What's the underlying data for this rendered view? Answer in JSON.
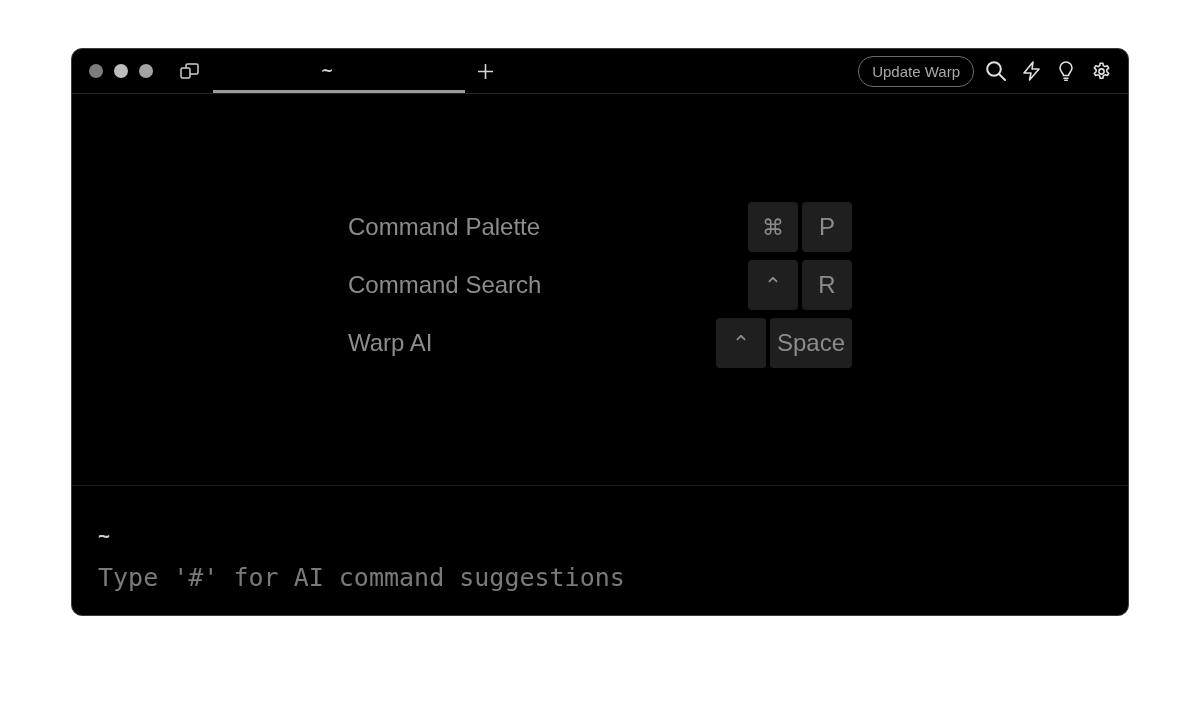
{
  "window": {
    "tabs": [
      {
        "title": "~",
        "selected": true
      }
    ],
    "update_button": "Update Warp"
  },
  "shortcuts": [
    {
      "label": "Command Palette",
      "keys": [
        "⌘",
        "P"
      ]
    },
    {
      "label": "Command Search",
      "keys": [
        "⌃",
        "R"
      ]
    },
    {
      "label": "Warp AI",
      "keys": [
        "⌃",
        "Space"
      ]
    }
  ],
  "prompt": {
    "directory": "~",
    "placeholder": "Type '#' for AI command suggestions"
  }
}
